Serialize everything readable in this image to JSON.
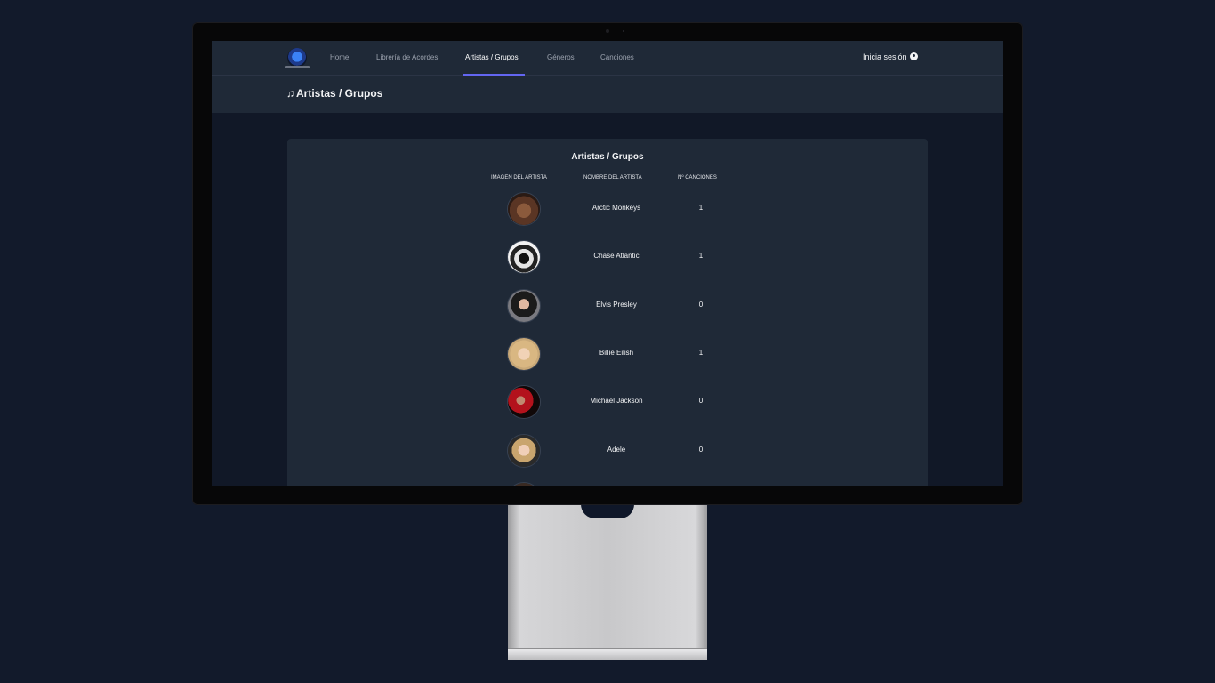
{
  "nav": {
    "items": [
      {
        "label": "Home"
      },
      {
        "label": "Librería de Acordes"
      },
      {
        "label": "Artistas / Grupos"
      },
      {
        "label": "Géneros"
      },
      {
        "label": "Canciones"
      }
    ],
    "login_label": "Inicia sesión"
  },
  "header": {
    "title": "Artistas / Grupos"
  },
  "table": {
    "title": "Artistas / Grupos",
    "columns": [
      "Imagen del artista",
      "Nombre del artista",
      "Nº canciones"
    ],
    "rows": [
      {
        "name": "Arctic Monkeys",
        "count": "1"
      },
      {
        "name": "Chase Atlantic",
        "count": "1"
      },
      {
        "name": "Elvis Presley",
        "count": "0"
      },
      {
        "name": "Billie Eilish",
        "count": "1"
      },
      {
        "name": "Michael Jackson",
        "count": "0"
      },
      {
        "name": "Adele",
        "count": "0"
      }
    ]
  },
  "colors": {
    "page_bg": "#111827",
    "panel_bg": "#1f2937",
    "accent": "#6366f1"
  }
}
